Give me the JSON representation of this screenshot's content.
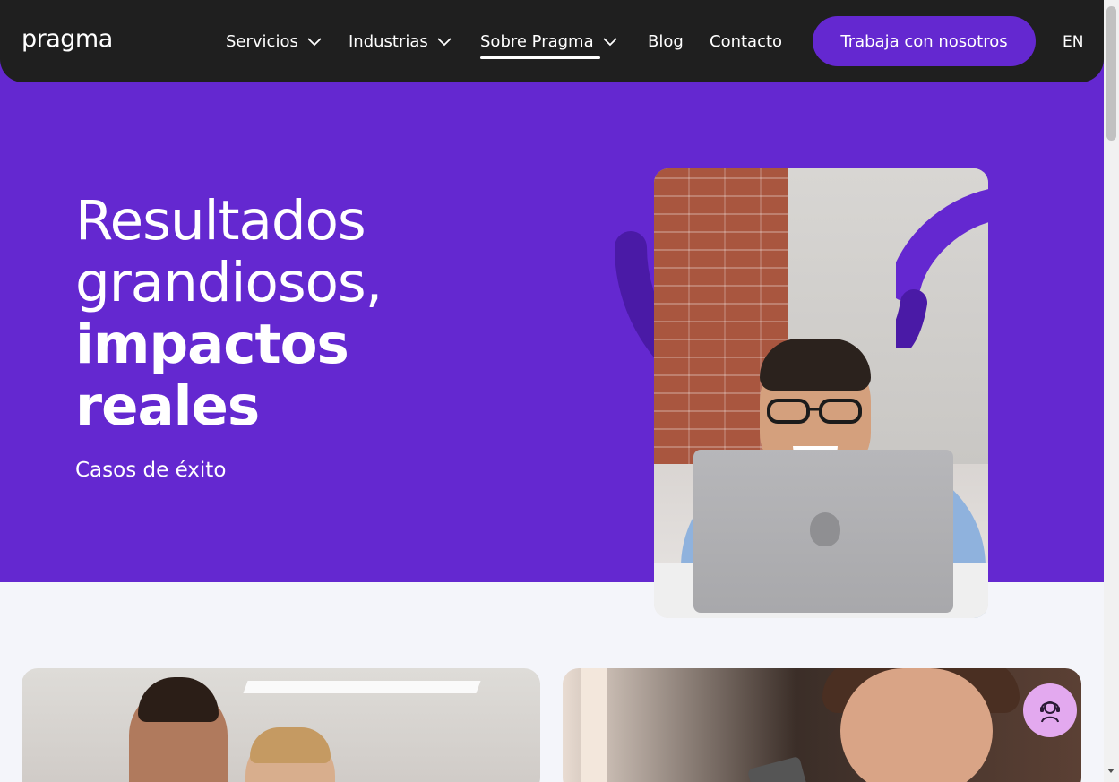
{
  "nav": {
    "logo": "pragma",
    "items": [
      {
        "label": "Servicios",
        "dropdown": true
      },
      {
        "label": "Industrias",
        "dropdown": true
      },
      {
        "label": "Sobre Pragma",
        "dropdown": true,
        "active": true
      },
      {
        "label": "Blog",
        "dropdown": false
      },
      {
        "label": "Contacto",
        "dropdown": false
      }
    ],
    "cta": "Trabaja con nosotros",
    "language": "EN"
  },
  "hero": {
    "title_line1": "Resultados",
    "title_line2": "grandiosos,",
    "title_line3": "impactos",
    "title_line4": "reales",
    "subtitle": "Casos de éxito"
  },
  "colors": {
    "brand_purple": "#6428d0",
    "nav_dark": "#1f1f1f",
    "chat_pink": "#e3a9ef",
    "page_bg": "#f4f5fa"
  },
  "icons": {
    "chevron": "chevron-down-icon",
    "chat": "support-agent-icon"
  }
}
